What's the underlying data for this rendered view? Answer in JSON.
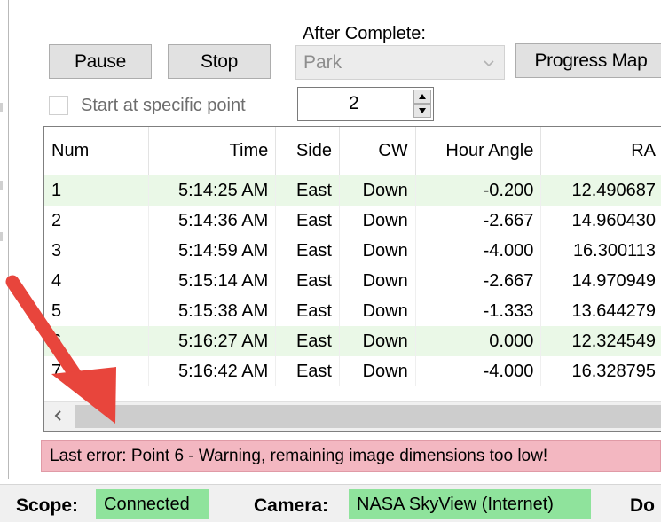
{
  "controls": {
    "pause_label": "Pause",
    "stop_label": "Stop",
    "after_complete_label": "After Complete:",
    "after_complete_value": "Park",
    "progress_map_label": "Progress Map",
    "start_point_label": "Start at specific point",
    "start_point_value": "2"
  },
  "table": {
    "headers": [
      "Num",
      "Time",
      "Side",
      "CW",
      "Hour Angle",
      "RA"
    ],
    "rows": [
      {
        "num": "1",
        "time": "5:14:25 AM",
        "side": "East",
        "cw": "Down",
        "ha": "-0.200",
        "ra": "12.490687",
        "highlight": true
      },
      {
        "num": "2",
        "time": "5:14:36 AM",
        "side": "East",
        "cw": "Down",
        "ha": "-2.667",
        "ra": "14.960430",
        "highlight": false
      },
      {
        "num": "3",
        "time": "5:14:59 AM",
        "side": "East",
        "cw": "Down",
        "ha": "-4.000",
        "ra": "16.300113",
        "highlight": false
      },
      {
        "num": "4",
        "time": "5:15:14 AM",
        "side": "East",
        "cw": "Down",
        "ha": "-2.667",
        "ra": "14.970949",
        "highlight": false
      },
      {
        "num": "5",
        "time": "5:15:38 AM",
        "side": "East",
        "cw": "Down",
        "ha": "-1.333",
        "ra": "13.644279",
        "highlight": false
      },
      {
        "num": "6",
        "time": "5:16:27 AM",
        "side": "East",
        "cw": "Down",
        "ha": "0.000",
        "ra": "12.324549",
        "highlight": true
      },
      {
        "num": "7",
        "time": "5:16:42 AM",
        "side": "East",
        "cw": "Down",
        "ha": "-4.000",
        "ra": "16.328795",
        "highlight": false
      }
    ]
  },
  "error": {
    "message": "Last error: Point 6 - Warning, remaining image dimensions too low!"
  },
  "status": {
    "scope_label": "Scope:",
    "scope_value": "Connected",
    "camera_label": "Camera:",
    "camera_value": "NASA SkyView (Internet)",
    "next_label_partial": "Do"
  },
  "colors": {
    "highlight_row": "#eaf8e7",
    "error_bg": "#f3b7c1",
    "status_badge": "#8fe39c",
    "annotation_arrow": "#e8453c"
  },
  "icons": {
    "combo": "chevron-down-icon",
    "spin_up": "arrow-up-icon",
    "spin_down": "arrow-down-icon",
    "scroll_left": "chevron-left-icon",
    "annotation": "red-arrow-annotation"
  }
}
